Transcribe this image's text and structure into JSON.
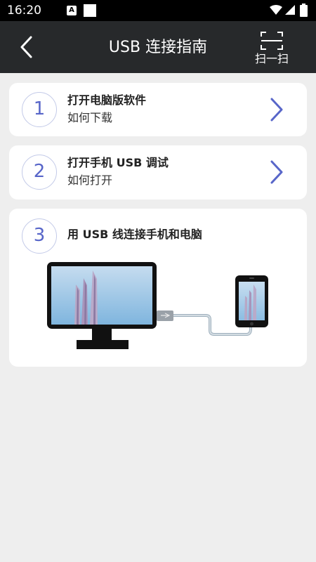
{
  "status_bar": {
    "time": "16:20",
    "notification_icon_letter": "A",
    "icons": [
      "notification-a-icon",
      "notification-square-icon",
      "wifi-icon",
      "signal-icon",
      "battery-icon"
    ]
  },
  "app_bar": {
    "title": "USB 连接指南",
    "scan_label": "扫一扫",
    "back_icon": "chevron-left-icon",
    "scan_icon": "scan-frame-icon"
  },
  "steps": [
    {
      "number": "1",
      "title": "打开电脑版软件",
      "subtitle": "如何下载"
    },
    {
      "number": "2",
      "title": "打开手机 USB 调试",
      "subtitle": "如何打开"
    },
    {
      "number": "3",
      "title": "用 USB 线连接手机和电脑"
    }
  ],
  "colors": {
    "accent": "#5866c9",
    "app_bar": "#27292b",
    "background": "#eeeeee",
    "card": "#ffffff"
  }
}
